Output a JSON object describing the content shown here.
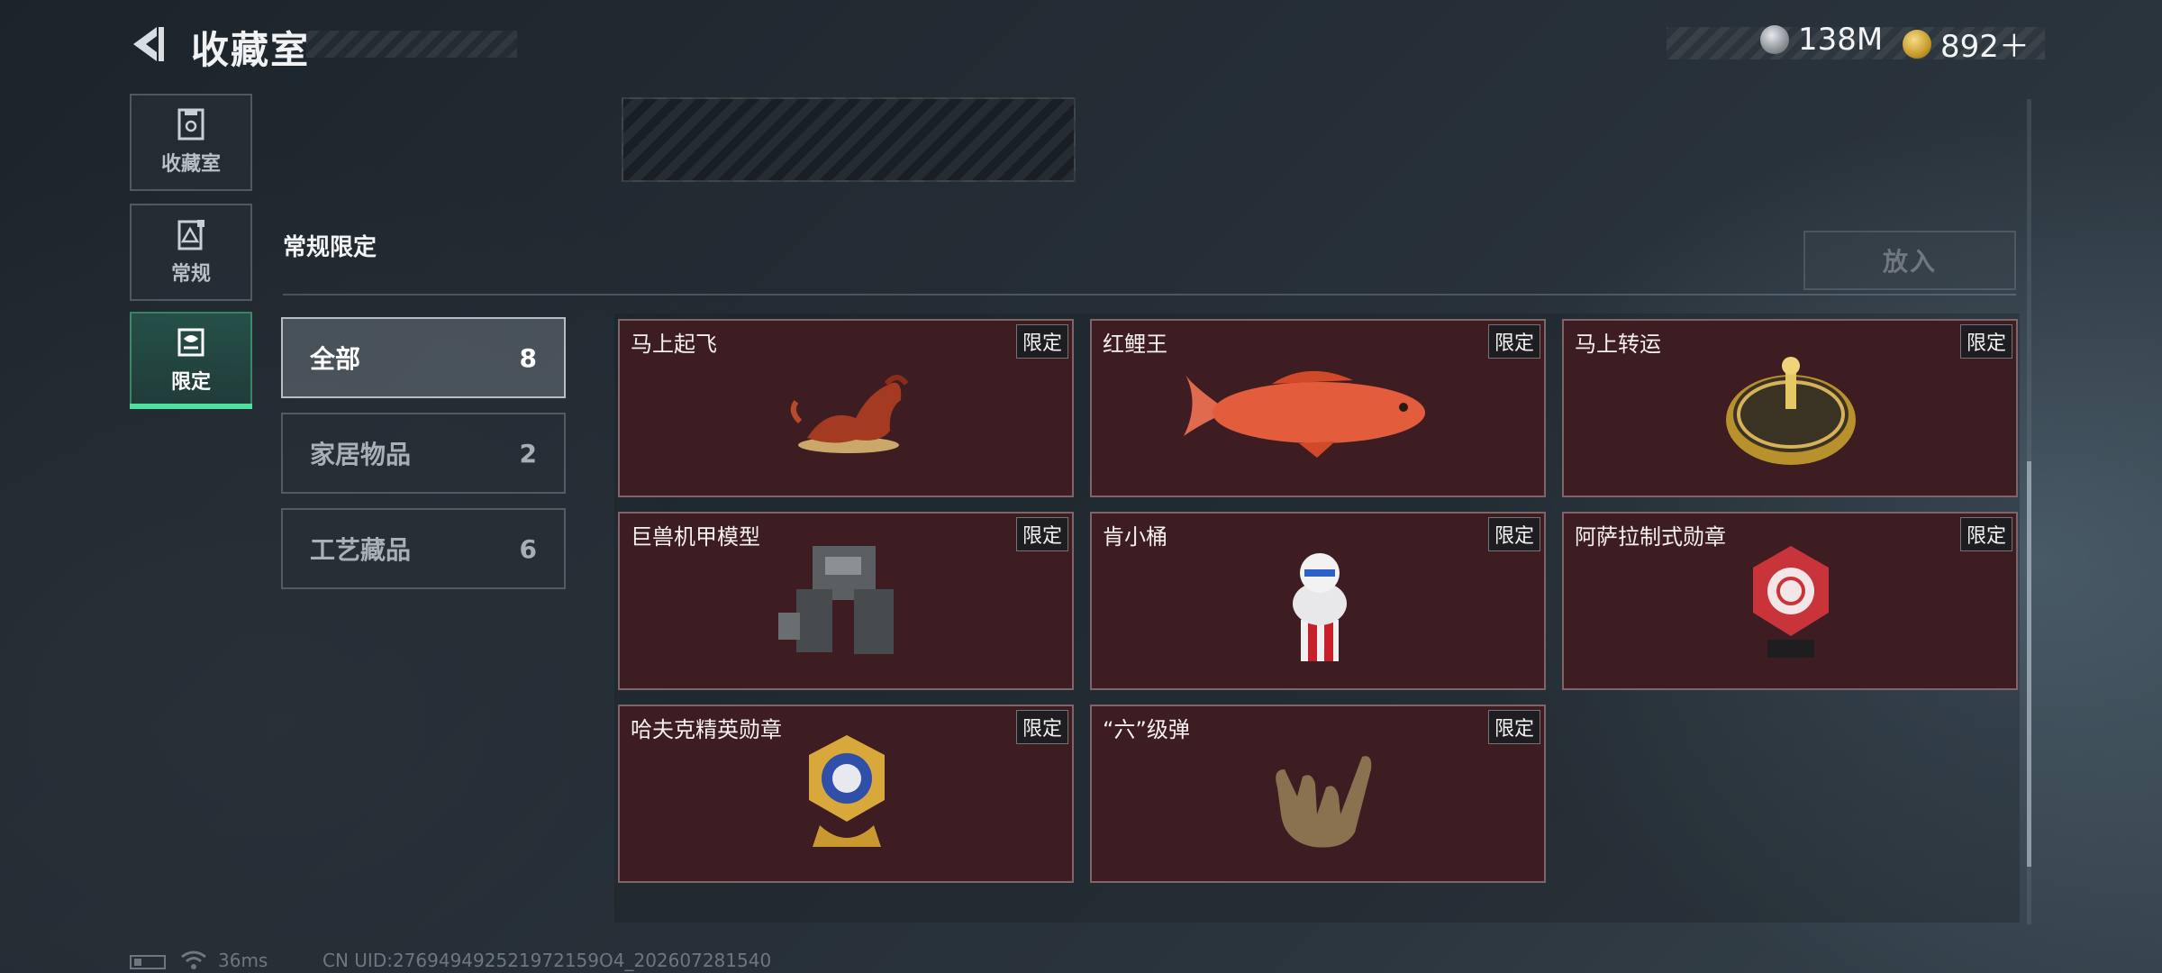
{
  "header": {
    "title": "收藏室"
  },
  "currency": {
    "silver": {
      "icon": "silver-coin-icon",
      "value": "138M"
    },
    "gold": {
      "icon": "gold-coin-icon",
      "value": "892＋"
    }
  },
  "nav": [
    {
      "label": "收藏室",
      "icon": "collection-room-icon"
    },
    {
      "label": "常规",
      "icon": "regular-card-icon"
    },
    {
      "label": "限定",
      "icon": "limited-card-icon",
      "active": true
    }
  ],
  "section": {
    "title": "常规限定",
    "put_in_label": "放入"
  },
  "filters": [
    {
      "label": "全部",
      "count": "8",
      "active": true
    },
    {
      "label": "家居物品",
      "count": "2"
    },
    {
      "label": "工艺藏品",
      "count": "6"
    }
  ],
  "items": [
    {
      "name": "马上起飞",
      "badge": "限定",
      "art": "horse-statue"
    },
    {
      "name": "红鲤王",
      "badge": "限定",
      "art": "red-carp"
    },
    {
      "name": "马上转运",
      "badge": "限定",
      "art": "gold-wheel"
    },
    {
      "name": "巨兽机甲模型",
      "badge": "限定",
      "art": "mech-model"
    },
    {
      "name": "肯小桶",
      "badge": "限定",
      "art": "bucket-figure"
    },
    {
      "name": "阿萨拉制式勋章",
      "badge": "限定",
      "art": "red-medal"
    },
    {
      "name": "哈夫克精英勋章",
      "badge": "限定",
      "art": "gold-medal"
    },
    {
      "name": "“六”级弹",
      "badge": "限定",
      "art": "hand-sign"
    }
  ],
  "footer": {
    "ping": "36ms",
    "uid": "CN UID:276949492521972159O4_202607281540"
  },
  "colors": {
    "accent": "#4fe0a0",
    "card_bg": "#3d1c22"
  }
}
